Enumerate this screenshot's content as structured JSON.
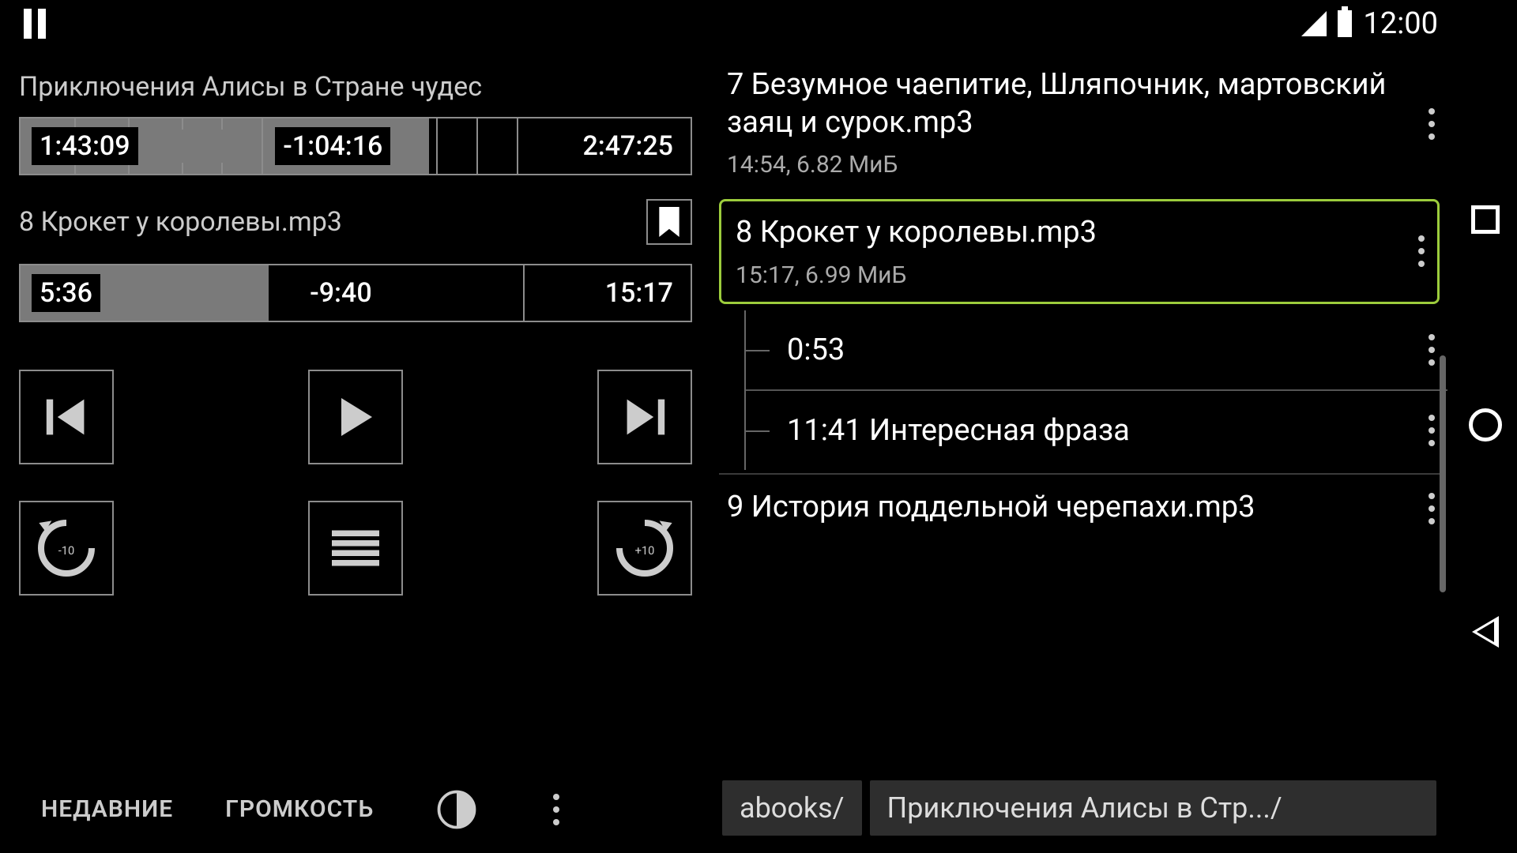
{
  "status": {
    "clock": "12:00"
  },
  "player": {
    "book_title": "Приключения Алисы в Стране чудес",
    "book_progress": {
      "elapsed": "1:43:09",
      "remaining": "-1:04:16",
      "total": "2:47:25",
      "fill_percent": 61
    },
    "current_track": "8 Крокет у королевы.mp3",
    "track_progress": {
      "elapsed": "5:36",
      "remaining": "-9:40",
      "total": "15:17",
      "fill_percent": 37
    },
    "rewind_label": "-10",
    "forward_label": "+10",
    "bottom": {
      "recent": "НЕДАВНИЕ",
      "volume": "ГРОМКОСТЬ"
    }
  },
  "tracks": [
    {
      "title": "7 Безумное чаепитие, Шляпочник, мартовский заяц и сурок.mp3",
      "meta": "14:54, 6.82 МиБ",
      "selected": false
    },
    {
      "title": "8 Крокет у королевы.mp3",
      "meta": "15:17, 6.99 МиБ",
      "selected": true
    },
    {
      "title": "9 История поддельной черепахи.mp3",
      "meta": "",
      "selected": false
    }
  ],
  "bookmarks": [
    {
      "text": "0:53"
    },
    {
      "text": "11:41 Интересная фраза"
    }
  ],
  "breadcrumbs": {
    "root": "abooks/",
    "current": "Приключения Алисы в Стр.../"
  }
}
